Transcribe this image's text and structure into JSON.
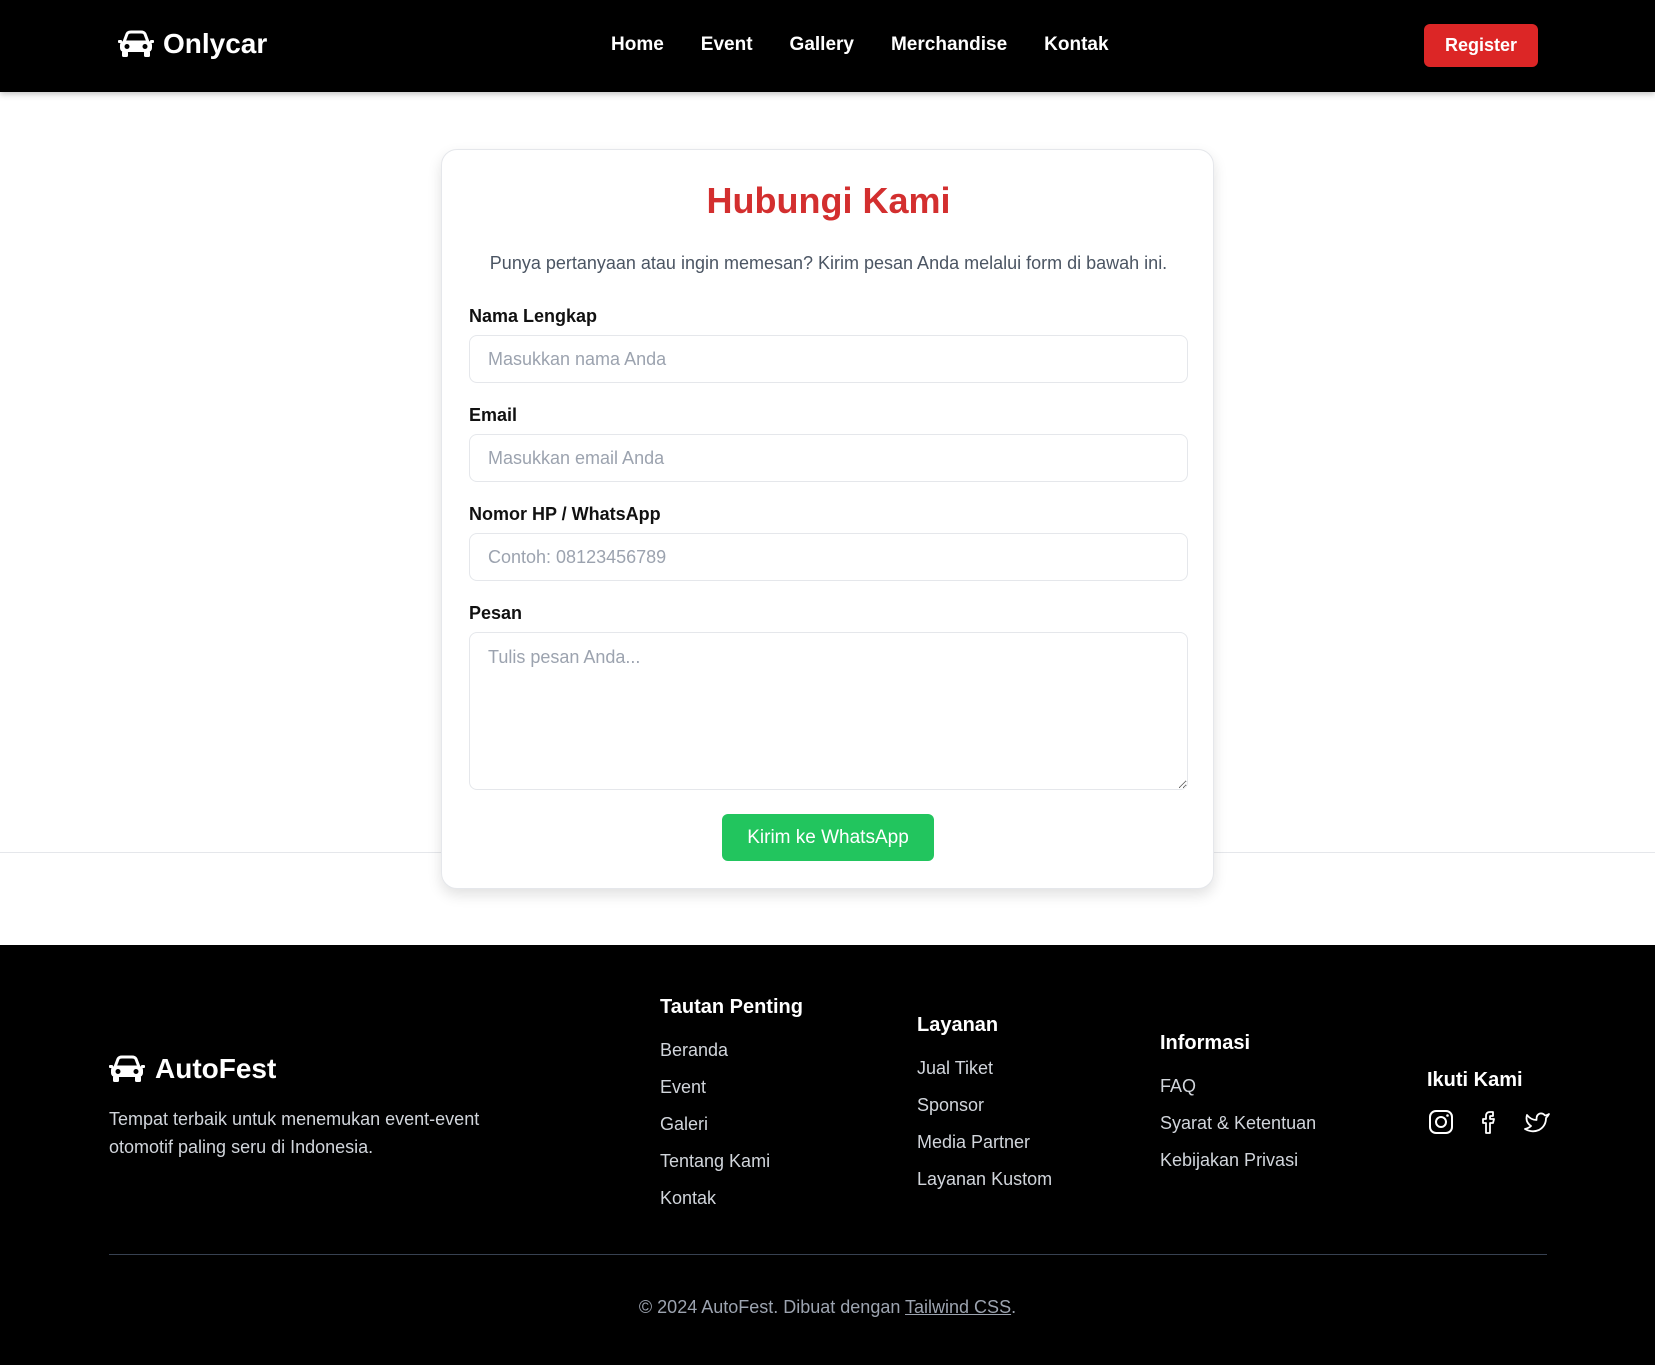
{
  "navbar": {
    "brand": "Onlycar",
    "brand_icon": "car-icon",
    "links": [
      "Home",
      "Event",
      "Gallery",
      "Merchandise",
      "Kontak"
    ],
    "register_label": "Register"
  },
  "contact": {
    "title": "Hubungi Kami",
    "subtitle": "Punya pertanyaan atau ingin memesan? Kirim pesan Anda melalui form di bawah ini.",
    "name_label": "Nama Lengkap",
    "name_placeholder": "Masukkan nama Anda",
    "email_label": "Email",
    "email_placeholder": "Masukkan email Anda",
    "phone_label": "Nomor HP / WhatsApp",
    "phone_placeholder": "Contoh: 08123456789",
    "message_label": "Pesan",
    "message_placeholder": "Tulis pesan Anda...",
    "submit_label": "Kirim ke WhatsApp"
  },
  "footer": {
    "brand": "AutoFest",
    "tagline": "Tempat terbaik untuk menemukan event-event otomotif paling seru di Indonesia.",
    "col1": {
      "title": "Tautan Penting",
      "links": [
        "Beranda",
        "Event",
        "Galeri",
        "Tentang Kami",
        "Kontak"
      ]
    },
    "col2": {
      "title": "Layanan",
      "links": [
        "Jual Tiket",
        "Sponsor",
        "Media Partner",
        "Layanan Kustom"
      ]
    },
    "col3": {
      "title": "Informasi",
      "links": [
        "FAQ",
        "Syarat & Ketentuan",
        "Kebijakan Privasi"
      ]
    },
    "social": {
      "title": "Ikuti Kami",
      "icons": [
        "instagram-icon",
        "facebook-icon",
        "twitter-icon"
      ]
    },
    "copyright_prefix": "© 2024 AutoFest. Dibuat dengan ",
    "copyright_link": "Tailwind CSS",
    "copyright_suffix": "."
  },
  "colors": {
    "accent_red": "#dc2626",
    "title_red": "#d32f2f",
    "whatsapp_green": "#22c55e",
    "nav_bg": "#000000"
  }
}
